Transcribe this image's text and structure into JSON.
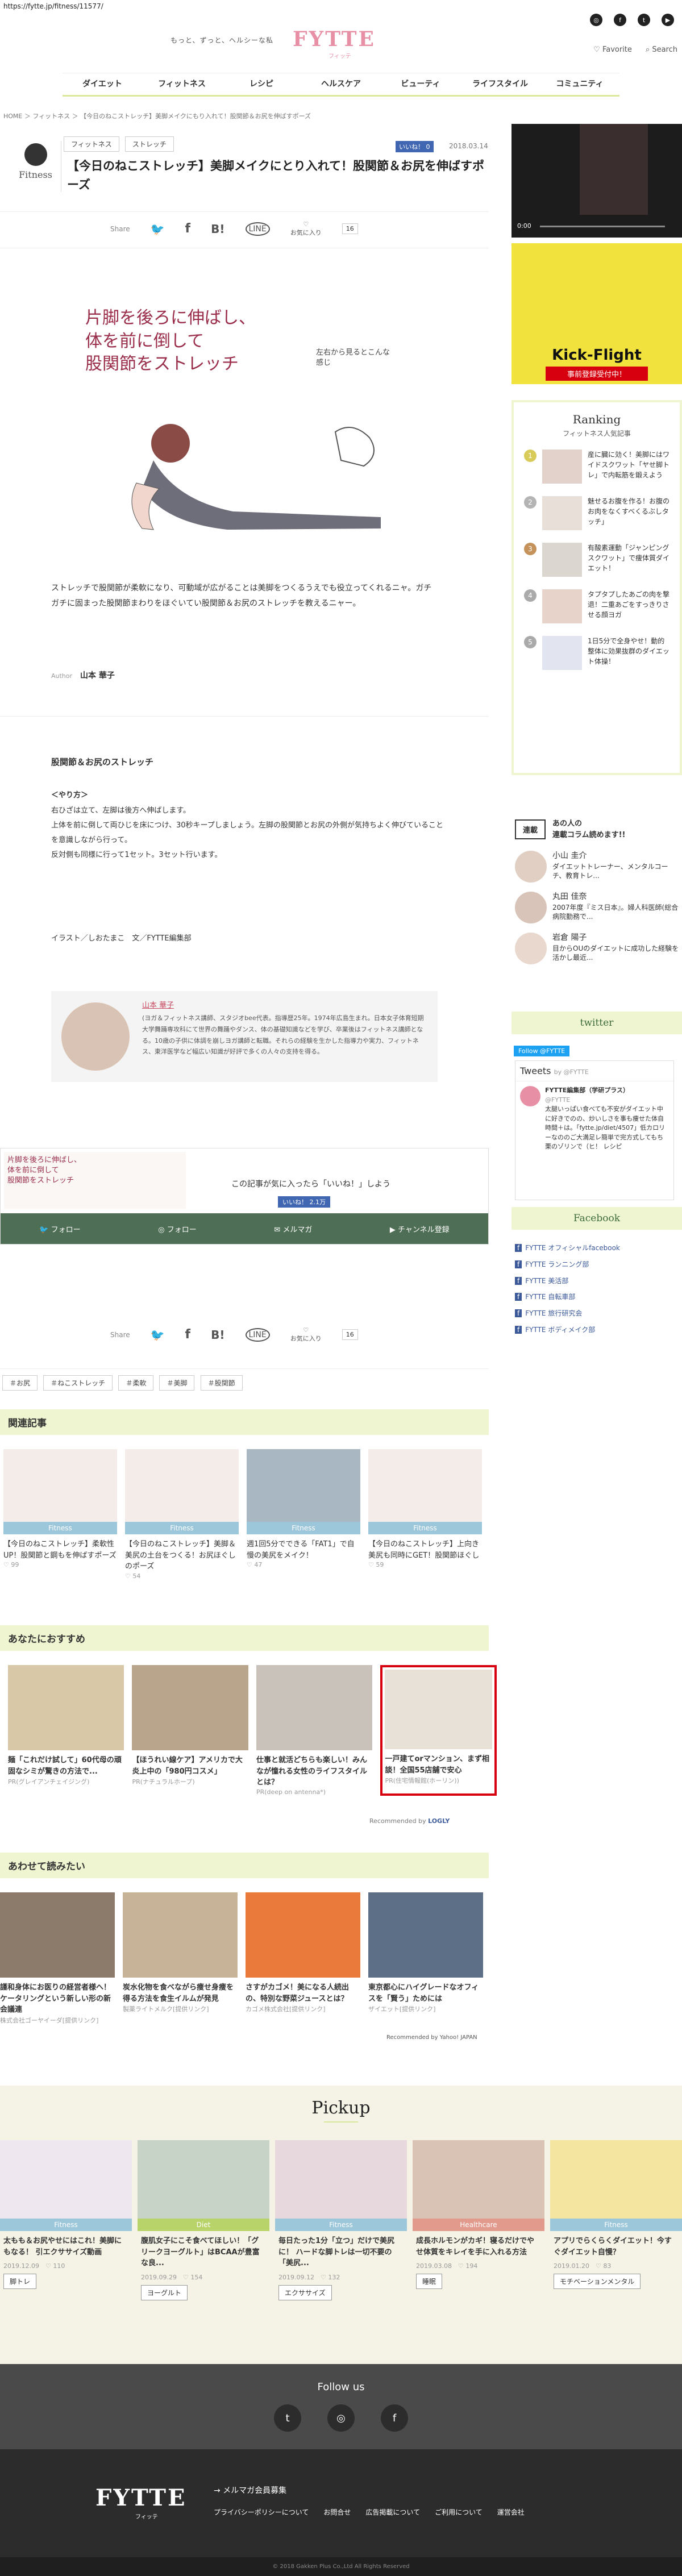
{
  "url": "https://fytte.jp/fitness/11577/",
  "header": {
    "tagline": "もっと、ずっと、ヘルシーな私",
    "logo": "FYTTE",
    "logo_sub": "フィッテ",
    "favorite": "Favorite",
    "search": "Search"
  },
  "nav": [
    "ダイエット",
    "フィットネス",
    "レシピ",
    "ヘルスケア",
    "ビューティ",
    "ライフスタイル",
    "コミュニティ"
  ],
  "breadcrumb": "HOME ＞ フィットネス ＞ 【今日のねこストレッチ】美脚メイクにもり入れて！股関節＆お尻を伸ばすポーズ",
  "article": {
    "category": "Fitness",
    "tags": [
      "フィットネス",
      "ストレッチ"
    ],
    "like": "いいね！",
    "like_count": "0",
    "date": "2018.03.14",
    "title": "【今日のねこストレッチ】美脚メイクにとり入れて！股関節＆お尻を伸ばすポーズ",
    "share_label": "Share",
    "fav_label": "お気に入り",
    "fav_count": "16",
    "hero_text_1": "片脚を後ろに伸ばし、",
    "hero_text_2": "体を前に倒して",
    "hero_text_3": "股関節をストレッチ",
    "hero_note": "左右から見るとこんな感じ",
    "lead": "ストレッチで股関節が柔軟になり、可動域が広がることは美脚をつくるうえでも役立ってくれるニャ。ガチガチに固まった股関節まわりをほぐいてい股関節＆お尻のストレッチを教えるニャー。",
    "author_label": "Author",
    "author": "山本 華子",
    "sub_title": "股関節＆お尻のストレッチ",
    "howto_label": "＜やり方＞",
    "howto": "右ひざは立て、左脚は後方へ伸ばします。\n上体を前に倒して両ひじを床につけ、30秒キープしましょう。左脚の股関節とお尻の外側が気持ちよく伸びていることを意識しながら行って。\n反対側も同様に行って1セット。3セット行います。",
    "credit": "イラスト／しおたまこ　文／FYTTE編集部",
    "profile_name": "山本 華子",
    "profile_text": "(ヨガ＆フィットネス講師、スタジオbee代表。指導歴25年。1974年広島生まれ。日本女子体育短期大学舞踊専攻科にて世界の舞踊やダンス、体の基礎知識などを学び、卒業後はフィットネス講師となる。10歳の子供に体調を崩しヨガ講師と転職。それらの経験を生かした指導力や実力、フィットネス、東洋医学など幅広い知識が好評で多くの人々の支持を得る。"
  },
  "likebox": {
    "text": "この記事が気に入ったら「いいね！」しよう",
    "like": "いいね！ 2.1万",
    "follow_twitter": "フォロー",
    "follow_instagram": "フォロー",
    "mailmag": "メルマガ",
    "youtube": "チャンネル登録"
  },
  "article_tags": [
    "＃お尻",
    "＃ねこストレッチ",
    "＃柔軟",
    "＃美脚",
    "＃股関節"
  ],
  "related": {
    "title": "関連記事",
    "items": [
      {
        "label": "Fitness",
        "title": "【今日のねこストレッチ】柔軟性UP！股関節と鋼もを伸ばすポーズ",
        "count": "99"
      },
      {
        "label": "Fitness",
        "title": "【今日のねこストレッチ】美脚＆美尻の土台をつくる！お尻ほぐしのポーズ",
        "count": "54"
      },
      {
        "label": "Fitness",
        "title": "週1回5分でできる「FAT1」で自慢の美尻をメイク！",
        "count": "47"
      },
      {
        "label": "Fitness",
        "title": "【今日のねこストレッチ】上向き美尻も同時にGET！股関節ほぐし",
        "count": "59"
      }
    ]
  },
  "recommend": {
    "title": "あなたにおすすめ",
    "items": [
      {
        "title": "麺「これだけ試して」60代母の頑固なシミが驚きの方法で...",
        "src": "PR(グレイアンチェイジング)"
      },
      {
        "title": "【ほうれい線ケア】アメリカで大炎上中の「980円コスメ」",
        "src": "PR(ナチュラルホープ)"
      },
      {
        "title": "仕事と就活どちらも楽しい！みんなが憧れる女性のライフスタイルとは？",
        "src": "PR(deep on antenna*)"
      },
      {
        "title": "一戸建てorマンション、まず相談！全国55店舗で安心",
        "src": "PR(住宅情報館(ホーリン))"
      }
    ],
    "powered": "Recommended by",
    "logly": "LOGLY"
  },
  "together": {
    "title": "あわせて読みたい",
    "items": [
      {
        "title": "謹和身体にお医りの経営者様へ！ケータリングという新しい形の新会議連",
        "src": "株式会社ゴーヤイーダ[提供リンク]"
      },
      {
        "title": "炭水化物を食べながら痩せ身痩を得る方法を食生イルムが発見",
        "src": "製薬ライトメルク[提供リンク]"
      },
      {
        "title": "さすがカゴメ！美になる人続出の、特別な野菜ジュースとは？",
        "src": "カゴメ株式会社[提供リンク]"
      },
      {
        "title": "東京都心にハイグレードなオフィスを「賢う」ためには",
        "src": "ザイエット[提供リンク]"
      }
    ],
    "powered": "Recommended by Yahoo! JAPAN"
  },
  "pickup": {
    "title": "Pickup",
    "items": [
      {
        "label": "Fitness",
        "title": "太もも＆お尻やせにはこれ！美脚にもなる！ 引エクササイズ動画",
        "date": "2019.12.09",
        "count": "110",
        "btn": "脚トレ"
      },
      {
        "label": "Diet",
        "title": "腹肌女子にこそ食べてほしい！「グリークヨーグルト」はBCAAが豊富な良...",
        "date": "2019.09.29",
        "count": "154",
        "btn": "ヨーグルト"
      },
      {
        "label": "Fitness",
        "title": "毎日たった1分「立つ」だけで美尻に！ ハードな脚トレは一切不要の「美尻...",
        "date": "2019.09.12",
        "count": "132",
        "btn": "エクササイズ"
      },
      {
        "label": "Healthcare",
        "title": "成長ホルモンがカギ！寝るだけでやせ体質をキレイを手に入れる方法",
        "date": "2019.03.08",
        "count": "194",
        "btn": "睡眠"
      },
      {
        "label": "Fitness",
        "title": "アプリでらくらくダイエット！今すぐダイエット自慢？",
        "date": "2019.01.20",
        "count": "83",
        "btn": "モチベーションメンタル"
      }
    ]
  },
  "follow": {
    "title": "Follow us"
  },
  "footer": {
    "logo": "FYTTE",
    "logo_sub": "フィッテ",
    "mailmag": "→ メルマガ会員募集",
    "links": [
      "プライバシーポリシーについて",
      "お問合せ",
      "広告掲載について",
      "ご利用について",
      "運営会社"
    ],
    "copyright": "© 2018 Gakken Plus Co.,Ltd All Rights Reserved"
  },
  "sidebar": {
    "video_time": "0:00",
    "ad_text": "Kick-Flight",
    "ad_sub": "事前登録受付中！",
    "ranking_title": "Ranking",
    "ranking_sub": "フィットネス人気記事",
    "ranking": [
      {
        "num": "1",
        "text": "産に臓に効く！美脚にはワイドスクワット「ヤせ脚トレ」で内転筋を鍛えよう"
      },
      {
        "num": "2",
        "text": "魅せるお腹を作る！お腹のお肉をなくすべくるぶしタッチ」"
      },
      {
        "num": "3",
        "text": "有酸素運動「ジャンピングスクワット」で痩体質ダイエット！"
      },
      {
        "num": "4",
        "text": "タプタプしたあごの肉を撃退！二重あごをすっきりさせる顔ヨガ"
      },
      {
        "num": "5",
        "text": "1日5分で全身やせ！動的整体に効果抜群のダイエット体操！"
      }
    ],
    "serial_label": "連載",
    "serial_title": "あの人の\n連載コラム読めます!!",
    "serial": [
      {
        "name": "小山 圭介",
        "text": "ダイエットトレーナー、メンタルコーチ、教育トレ..."
      },
      {
        "name": "丸田 佳奈",
        "text": "2007年度『ミス日本』。婦人科医師(総合病院勤務で..."
      },
      {
        "name": "岩倉 陽子",
        "text": "目からOUのダイエットに成功した経験を活かし最近..."
      }
    ],
    "twitter_title": "twitter",
    "tw_follow": "Follow @FYTTE",
    "tweets_label": "Tweets",
    "tweets_by": "by @FYTTE",
    "tweet_name": "FYTTE編集部（学研プラス）",
    "tweet_handle": "@FYTTE",
    "tweet_text": "太腿いっぱい食べても不安がダイエット中に好きでのの、炒いしさを事も痩せた体自時間＋は。「fytte.jp/diet/4507」低カロリーなののご大満足レ簡単で完方式してもち栗のゾリンで（ヒ！ レシピ",
    "facebook_title": "Facebook",
    "fb_links": [
      "FYTTE オフィシャルfacebook",
      "FYTTE ランニング部",
      "FYTTE 美活部",
      "FYTTE 自転車部",
      "FYTTE 旅行研究会",
      "FYTTE ボディメイク部"
    ]
  },
  "colors": {
    "brand_pink": "#e78fa5",
    "accent_green": "#d9e89a",
    "section_green": "#eef5d0",
    "fb_blue": "#3b5998",
    "likebox_green": "#4e6e55"
  }
}
